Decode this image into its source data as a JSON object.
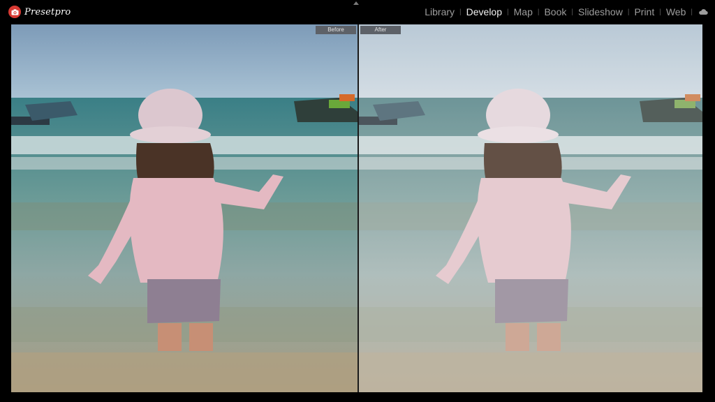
{
  "app": {
    "brand_name": "Presetpro"
  },
  "nav": {
    "modules": [
      {
        "label": "Library",
        "active": false
      },
      {
        "label": "Develop",
        "active": true
      },
      {
        "label": "Map",
        "active": false
      },
      {
        "label": "Book",
        "active": false
      },
      {
        "label": "Slideshow",
        "active": false
      },
      {
        "label": "Print",
        "active": false
      },
      {
        "label": "Web",
        "active": false
      }
    ],
    "cloud_icon": "cloud-icon"
  },
  "view": {
    "before_label": "Before",
    "after_label": "After"
  },
  "colors": {
    "brand_red": "#d83a33",
    "active_text": "#f2f2f2",
    "inactive_text": "#9d9d9d",
    "tag_bg": "#5d6168"
  }
}
